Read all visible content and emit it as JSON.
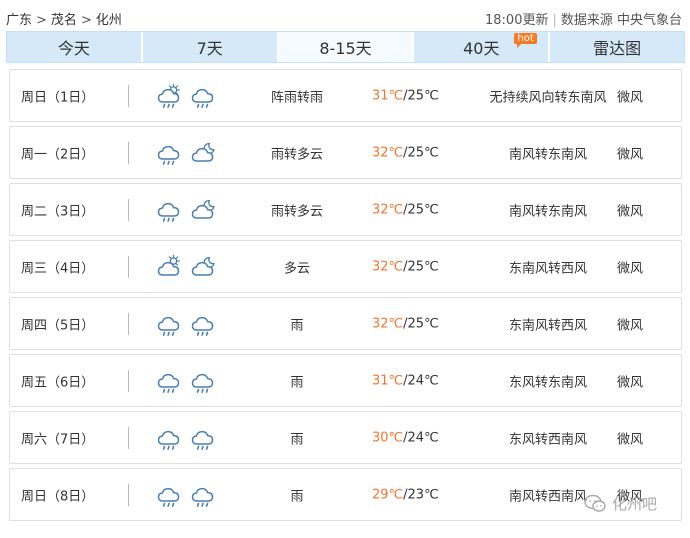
{
  "breadcrumb": {
    "items": [
      "广东",
      "茂名",
      "化州"
    ],
    "separator": ">"
  },
  "meta": {
    "update_time": "18:00更新",
    "source": "数据来源 中央气象台"
  },
  "tabs": [
    {
      "label": "今天",
      "active": false
    },
    {
      "label": "7天",
      "active": false
    },
    {
      "label": "8-15天",
      "active": true
    },
    {
      "label": "40天",
      "active": false,
      "badge": "hot"
    },
    {
      "label": "雷达图",
      "active": false
    }
  ],
  "forecast": [
    {
      "date": "周日（1日）",
      "icons": [
        "cloud-sun-rain-icon",
        "cloud-rain-icon"
      ],
      "desc": "阵雨转雨",
      "high": "31℃",
      "low": "/25℃",
      "wind": "无持续风向转东南风",
      "level": "微风"
    },
    {
      "date": "周一（2日）",
      "icons": [
        "cloud-rain-icon",
        "cloud-moon-icon"
      ],
      "desc": "雨转多云",
      "high": "32℃",
      "low": "/25℃",
      "wind": "南风转东南风",
      "level": "微风"
    },
    {
      "date": "周二（3日）",
      "icons": [
        "cloud-rain-icon",
        "cloud-moon-icon"
      ],
      "desc": "雨转多云",
      "high": "32℃",
      "low": "/25℃",
      "wind": "南风转东南风",
      "level": "微风"
    },
    {
      "date": "周三（4日）",
      "icons": [
        "cloud-sun-icon",
        "cloud-moon-icon"
      ],
      "desc": "多云",
      "high": "32℃",
      "low": "/25℃",
      "wind": "东南风转西风",
      "level": "微风"
    },
    {
      "date": "周四（5日）",
      "icons": [
        "cloud-rain-icon",
        "cloud-rain-icon"
      ],
      "desc": "雨",
      "high": "32℃",
      "low": "/25℃",
      "wind": "东南风转西风",
      "level": "微风"
    },
    {
      "date": "周五（6日）",
      "icons": [
        "cloud-rain-icon",
        "cloud-rain-icon"
      ],
      "desc": "雨",
      "high": "31℃",
      "low": "/24℃",
      "wind": "东风转东南风",
      "level": "微风"
    },
    {
      "date": "周六（7日）",
      "icons": [
        "cloud-rain-icon",
        "cloud-rain-icon"
      ],
      "desc": "雨",
      "high": "30℃",
      "low": "/24℃",
      "wind": "东风转西南风",
      "level": "微风"
    },
    {
      "date": "周日（8日）",
      "icons": [
        "cloud-rain-icon",
        "cloud-rain-icon"
      ],
      "desc": "雨",
      "high": "29℃",
      "low": "/23℃",
      "wind": "南风转西南风",
      "level": "微风"
    }
  ],
  "watermark": {
    "text": "化州吧"
  },
  "colors": {
    "tab_bg": "#d6e9f8",
    "tab_active_bg": "#f4fafe",
    "high_temp": "#f27430",
    "icon_stroke": "#4a7fb0",
    "badge": "#f47a23"
  }
}
